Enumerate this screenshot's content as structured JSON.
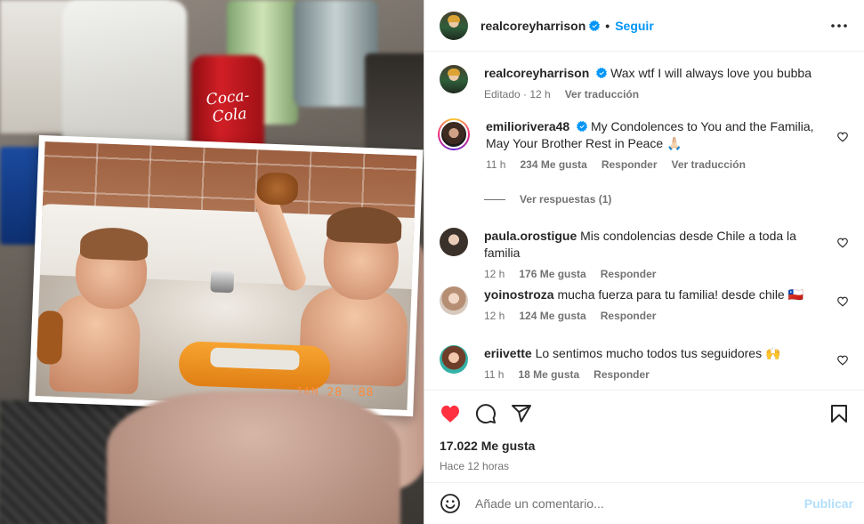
{
  "post": {
    "author": "realcoreyharrison",
    "follow_label": "Seguir",
    "dot": "•",
    "more_icon": "more-horizontal-icon",
    "photo_date_stamp": "JAN 28 '88",
    "photo_can_label": "Coca-Cola"
  },
  "comments": [
    {
      "user": "realcoreyharrison",
      "verified": true,
      "text": "Wax wtf I will always love you bubba",
      "time": "Editado · 12 h",
      "translate": "Ver traducción"
    },
    {
      "user": "emiliorivera48",
      "verified": true,
      "text": "My Condolences to You and the Familia, May Your Brother Rest in Peace 🙏🏻",
      "time": "11 h",
      "likes": "234 Me gusta",
      "reply": "Responder",
      "translate": "Ver traducción",
      "view_replies": "Ver respuestas (1)"
    },
    {
      "user": "paula.orostigue",
      "text": "Mis condolencias desde Chile a toda la familia",
      "time": "12 h",
      "likes": "176 Me gusta",
      "reply": "Responder"
    },
    {
      "user": "yoinostroza",
      "text": "mucha fuerza para tu familia! desde chile 🇨🇱",
      "time": "12 h",
      "likes": "124 Me gusta",
      "reply": "Responder"
    },
    {
      "user": "eriivette",
      "text": "Lo sentimos mucho todos tus seguidores 🙌",
      "time": "11 h",
      "likes": "18 Me gusta",
      "reply": "Responder"
    }
  ],
  "actions": {
    "liked": true,
    "like_color": "#ff3040",
    "likes_count": "17.022 Me gusta",
    "time_ago": "Hace 12 horas"
  },
  "add_comment": {
    "placeholder": "Añade un comentario...",
    "publish_label": "Publicar"
  },
  "colors": {
    "accent": "#0095f6",
    "publish_disabled": "#b2dffc",
    "muted": "#737373"
  }
}
